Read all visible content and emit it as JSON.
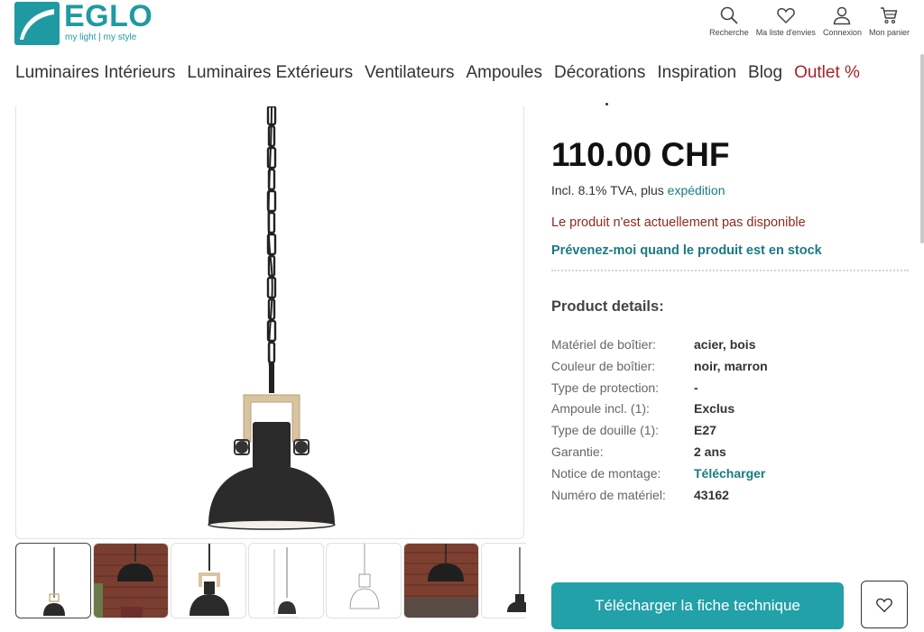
{
  "brand": {
    "name": "EGLO",
    "tagline": "my light | my style",
    "accent": "#1f9aa3"
  },
  "header_icons": [
    {
      "icon": "search-icon",
      "label": "Recherche"
    },
    {
      "icon": "heart-icon",
      "label": "Ma liste d'envies"
    },
    {
      "icon": "user-icon",
      "label": "Connexion"
    },
    {
      "icon": "cart-icon",
      "label": "Mon panier"
    }
  ],
  "nav": [
    {
      "label": "Luminaires Intérieurs"
    },
    {
      "label": "Luminaires Extérieurs"
    },
    {
      "label": "Ventilateurs"
    },
    {
      "label": "Ampoules"
    },
    {
      "label": "Décorations"
    },
    {
      "label": "Inspiration"
    },
    {
      "label": "Blog"
    },
    {
      "label": "Outlet %",
      "color": "#a6232b"
    }
  ],
  "product": {
    "price": "110.00 CHF",
    "tax_prefix": "Incl. 8.1% TVA, plus ",
    "tax_link": "expédition",
    "availability": "Le produit n'est actuellement pas disponible",
    "notify": "Prévenez-moi quand le produit est en stock",
    "details_title": "Product details:",
    "specs": [
      {
        "key": "Matériel de boîtier:",
        "value": "acier, bois"
      },
      {
        "key": "Couleur de boîtier:",
        "value": "noir, marron"
      },
      {
        "key": "Type de protection:",
        "value": "-"
      },
      {
        "key": "Ampoule incl. (1):",
        "value": "Exclus"
      },
      {
        "key": "Type de douille (1):",
        "value": "E27"
      },
      {
        "key": "Garantie:",
        "value": "2 ans"
      },
      {
        "key": "Notice de montage:",
        "value": "Télécharger",
        "link": true
      },
      {
        "key": "Numéro de matériel:",
        "value": "43162"
      }
    ],
    "download_button": "Télécharger la fiche technique",
    "button_color": "#22a1a8"
  },
  "thumbnails": [
    {
      "kind": "product-photo",
      "active": true
    },
    {
      "kind": "room-photo"
    },
    {
      "kind": "product-closeup"
    },
    {
      "kind": "dimension-drawing"
    },
    {
      "kind": "line-drawing"
    },
    {
      "kind": "room-photo"
    },
    {
      "kind": "product-photo"
    }
  ]
}
